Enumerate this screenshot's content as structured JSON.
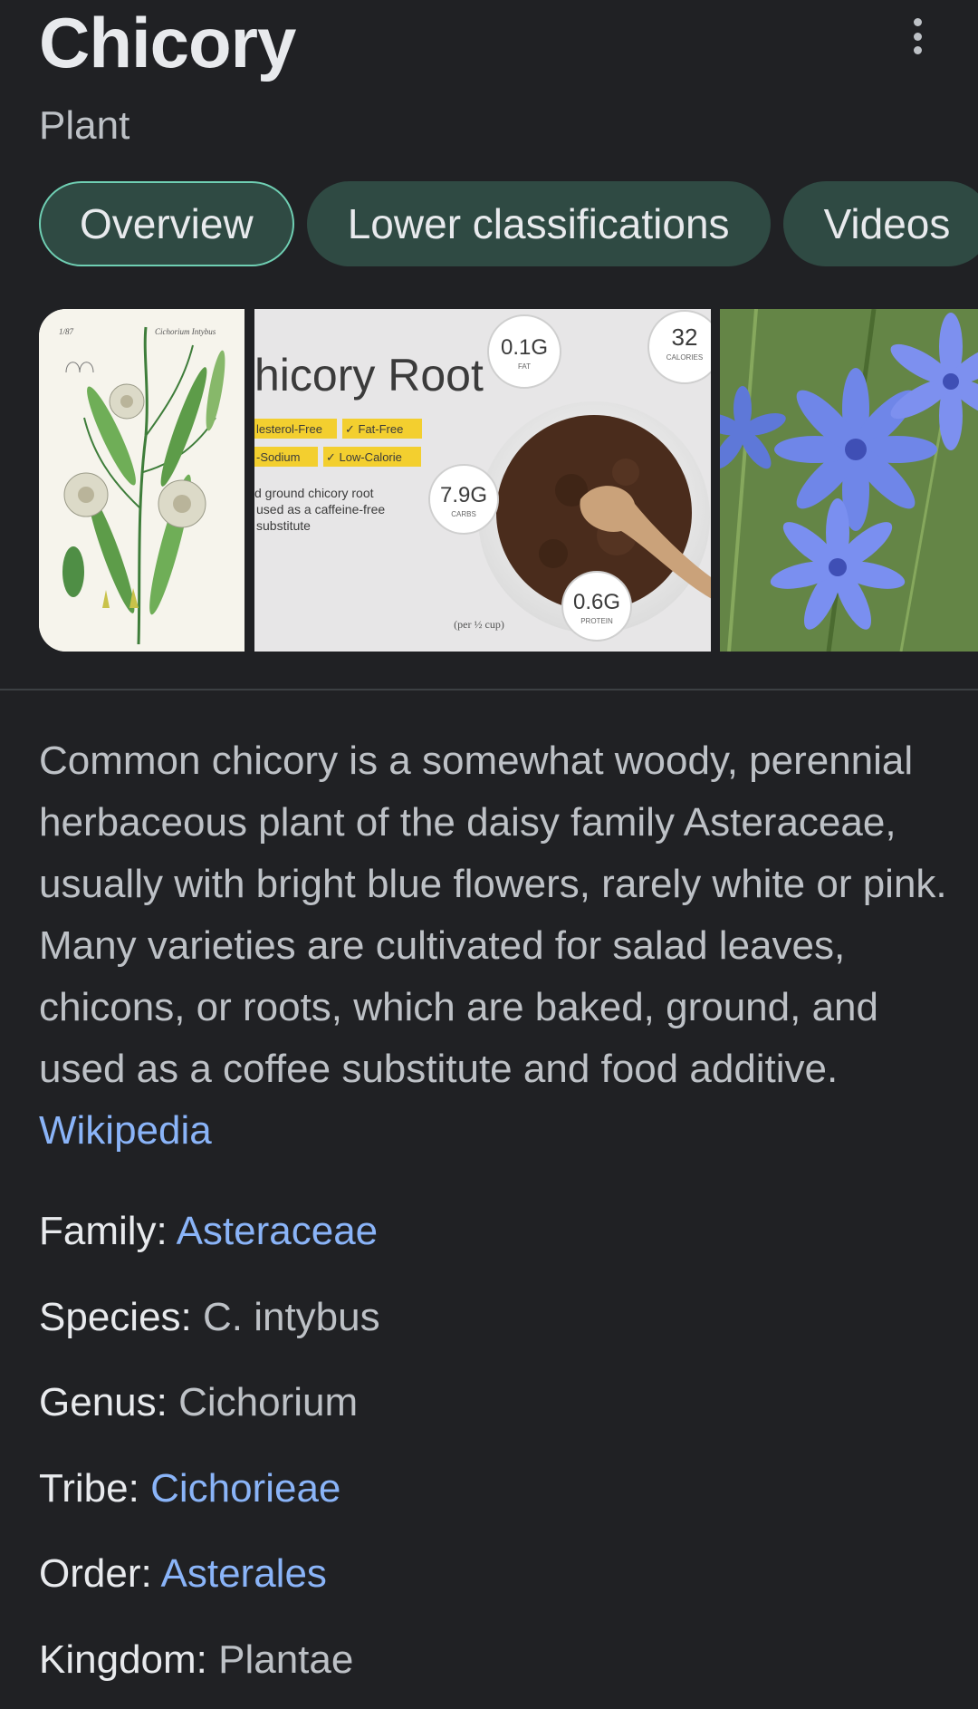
{
  "header": {
    "title": "Chicory",
    "subtitle": "Plant",
    "more_icon": "more-vert-icon"
  },
  "tabs": [
    {
      "label": "Overview",
      "active": true
    },
    {
      "label": "Lower classifications",
      "active": false
    },
    {
      "label": "Videos",
      "active": false
    }
  ],
  "images": {
    "botanical": {
      "label_left": "1/87",
      "label_right": "Cichorium Intybus"
    },
    "infographic": {
      "title": "hicory Root",
      "tags": [
        "lesterol-Free",
        "✓ Fat-Free",
        "-Sodium",
        "✓ Low-Calorie"
      ],
      "body": [
        "d ground chicory root",
        "used as a caffeine-free",
        "substitute"
      ],
      "fat": {
        "value": "0.1G",
        "unit": "FAT"
      },
      "calories": {
        "value": "32",
        "unit": "CALORIES"
      },
      "carbs": {
        "value": "7.9G",
        "unit": "CARBS"
      },
      "protein": {
        "value": "0.6G",
        "unit": "PROTEIN"
      },
      "serving": "(per ½ cup)"
    },
    "flowers": {}
  },
  "description": {
    "text": "Common chicory is a somewhat woody, perennial herbaceous plant of the daisy family Asteraceae, usually with bright blue flowers, rarely white or pink. Many varieties are cultivated for salad leaves, chicons, or roots, which are baked, ground, and used as a coffee substitute and food additive. ",
    "source": "Wikipedia"
  },
  "facts": [
    {
      "label": "Family: ",
      "value": "Asteraceae",
      "link": true
    },
    {
      "label": "Species: ",
      "value": "C. intybus",
      "link": false
    },
    {
      "label": "Genus: ",
      "value": "Cichorium",
      "link": false
    },
    {
      "label": "Tribe: ",
      "value": "Cichorieae",
      "link": true
    },
    {
      "label": "Order: ",
      "value": "Asterales",
      "link": true
    },
    {
      "label": "Kingdom: ",
      "value": "Plantae",
      "link": false
    }
  ],
  "colors": {
    "background": "#202124",
    "link": "#8ab4f8",
    "tab_background": "#2f4a43",
    "tab_active_border": "#6fcfb3"
  }
}
